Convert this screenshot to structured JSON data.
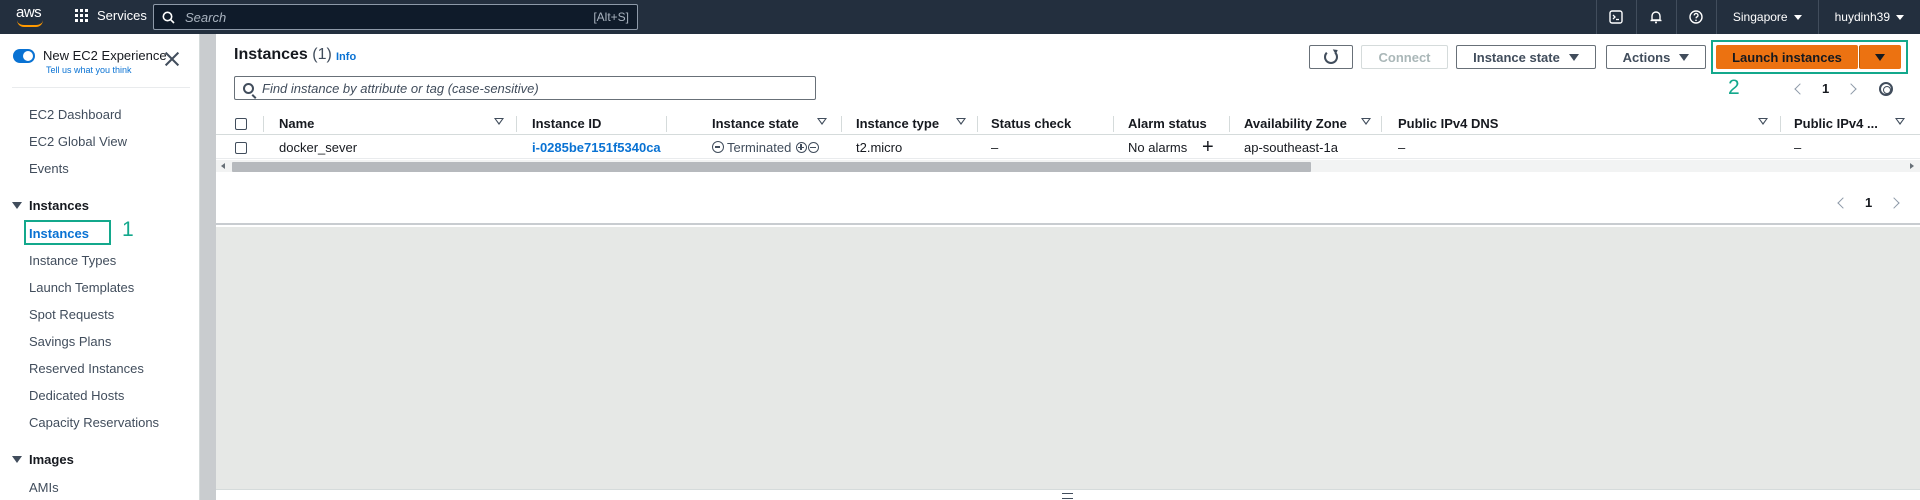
{
  "topbar": {
    "logo_text": "aws",
    "services_label": "Services",
    "search_placeholder": "Search",
    "search_shortcut": "[Alt+S]",
    "region": "Singapore",
    "user": "huydinh39"
  },
  "sidebar": {
    "new_experience_title": "New EC2 Experience",
    "new_experience_link": "Tell us what you think",
    "top_items": [
      "EC2 Dashboard",
      "EC2 Global View",
      "Events"
    ],
    "instances_section": "Instances",
    "instances_items": [
      "Instances",
      "Instance Types",
      "Launch Templates",
      "Spot Requests",
      "Savings Plans",
      "Reserved Instances",
      "Dedicated Hosts",
      "Capacity Reservations"
    ],
    "images_section": "Images",
    "images_items": [
      "AMIs"
    ],
    "annotation_1": "1"
  },
  "main": {
    "title": "Instances",
    "count": "(1)",
    "info_link": "Info",
    "buttons": {
      "connect": "Connect",
      "instance_state": "Instance state",
      "actions": "Actions",
      "launch": "Launch instances"
    },
    "annotation_2": "2",
    "filter_placeholder": "Find instance by attribute or tag (case-sensitive)",
    "page_number": "1",
    "columns": [
      "Name",
      "Instance ID",
      "Instance state",
      "Instance type",
      "Status check",
      "Alarm status",
      "Availability Zone",
      "Public IPv4 DNS",
      "Public IPv4 ..."
    ],
    "row": {
      "name": "docker_sever",
      "instance_id": "i-0285be7151f5340ca",
      "state": "Terminated",
      "type": "t2.micro",
      "status_check": "–",
      "alarm_status": "No alarms",
      "alarm_add": "+",
      "az": "ap-southeast-1a",
      "dns": "–",
      "ipv4": "–"
    },
    "bottom_page_number": "1"
  },
  "colors": {
    "topbar_bg": "#232f3e",
    "link_blue": "#0972d3",
    "primary_orange": "#ec7211",
    "annotation_green": "#13a88c"
  }
}
